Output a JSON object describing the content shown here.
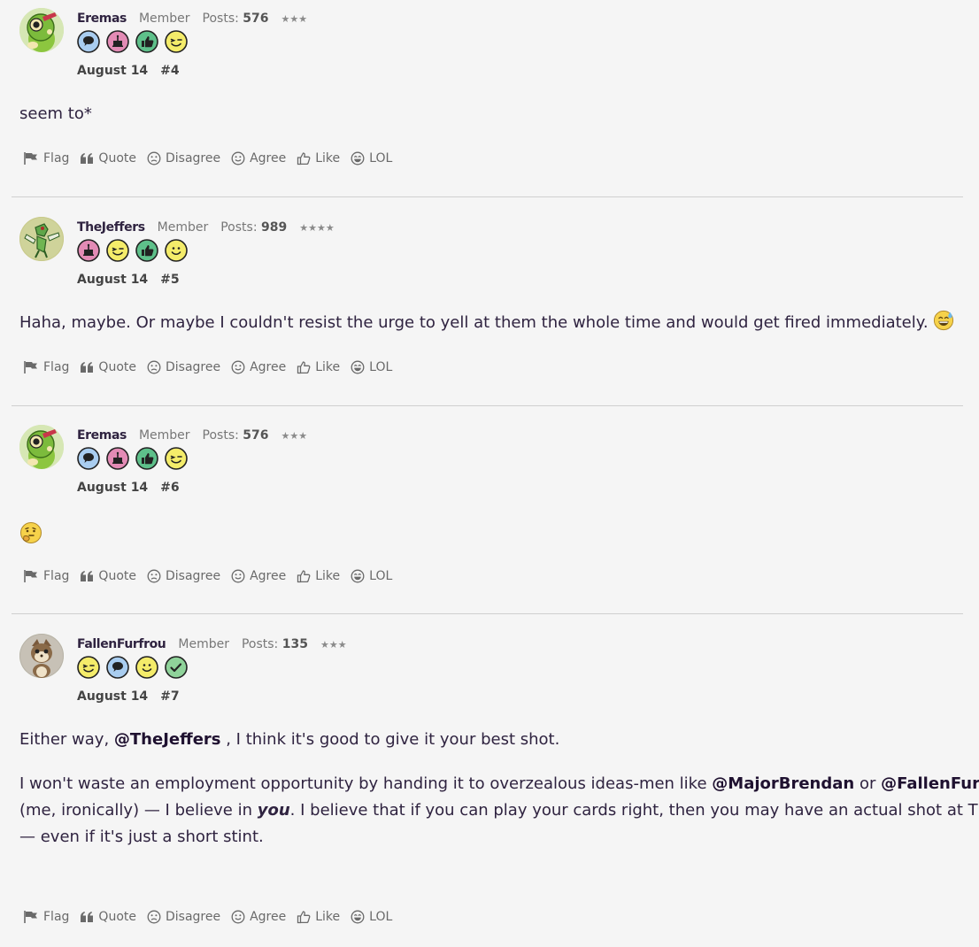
{
  "actions": {
    "flag": "Flag",
    "quote": "Quote",
    "disagree": "Disagree",
    "agree": "Agree",
    "like": "Like",
    "lol": "LOL"
  },
  "posts": [
    {
      "username": "Eremas",
      "role": "Member",
      "posts_label": "Posts:",
      "posts_count": "576",
      "stars": "★★★",
      "date": "August 14",
      "number": "#4",
      "badges": [
        "speech-bubble-icon",
        "cake-icon",
        "thumbs-up-icon",
        "wink-icon"
      ],
      "text": "seem to*"
    },
    {
      "username": "TheJeffers",
      "role": "Member",
      "posts_label": "Posts:",
      "posts_count": "989",
      "stars": "★★★★",
      "date": "August 14",
      "number": "#5",
      "badges": [
        "cake-icon",
        "wink-icon",
        "thumbs-up-icon",
        "smile-icon"
      ],
      "text": "Haha, maybe. Or maybe I couldn't resist the urge to yell at them the whole time and would get fired immediately.",
      "trailing_emoji": "sweat-smile-emoji"
    },
    {
      "username": "Eremas",
      "role": "Member",
      "posts_label": "Posts:",
      "posts_count": "576",
      "stars": "★★★",
      "date": "August 14",
      "number": "#6",
      "badges": [
        "speech-bubble-icon",
        "cake-icon",
        "thumbs-up-icon",
        "wink-icon"
      ],
      "emoji": "thinking-face-emoji"
    },
    {
      "username": "FallenFurfrou",
      "role": "Member",
      "posts_label": "Posts:",
      "posts_count": "135",
      "stars": "★★★",
      "date": "August 14",
      "number": "#7",
      "badges": [
        "wink-icon",
        "speech-bubble-icon",
        "smile-icon",
        "checkmark-icon"
      ],
      "p1_before": "Either way,",
      "p1_mention": "@TheJeffers",
      "p1_after": ", I think it's good to give it your best shot.",
      "p2_line1_before": "I won't waste an employment opportunity by handing it to overzealous ideas-men like",
      "p2_mention1": "@MajorBrendan",
      "p2_or": "or",
      "p2_mention2": "@FallenFurfrou",
      "p2_line2_before": "(me, ironically) — I believe in",
      "p2_you": "you",
      "p2_line2_after": ". I believe that if you can play your cards right, then you may have an actual shot at TPCI",
      "p2_line3": "— even if it's just a short stint."
    }
  ],
  "colors": {
    "background": "#f5f5f5",
    "text": "#2f2340",
    "muted": "#777777",
    "separator": "#cfcfcf"
  }
}
